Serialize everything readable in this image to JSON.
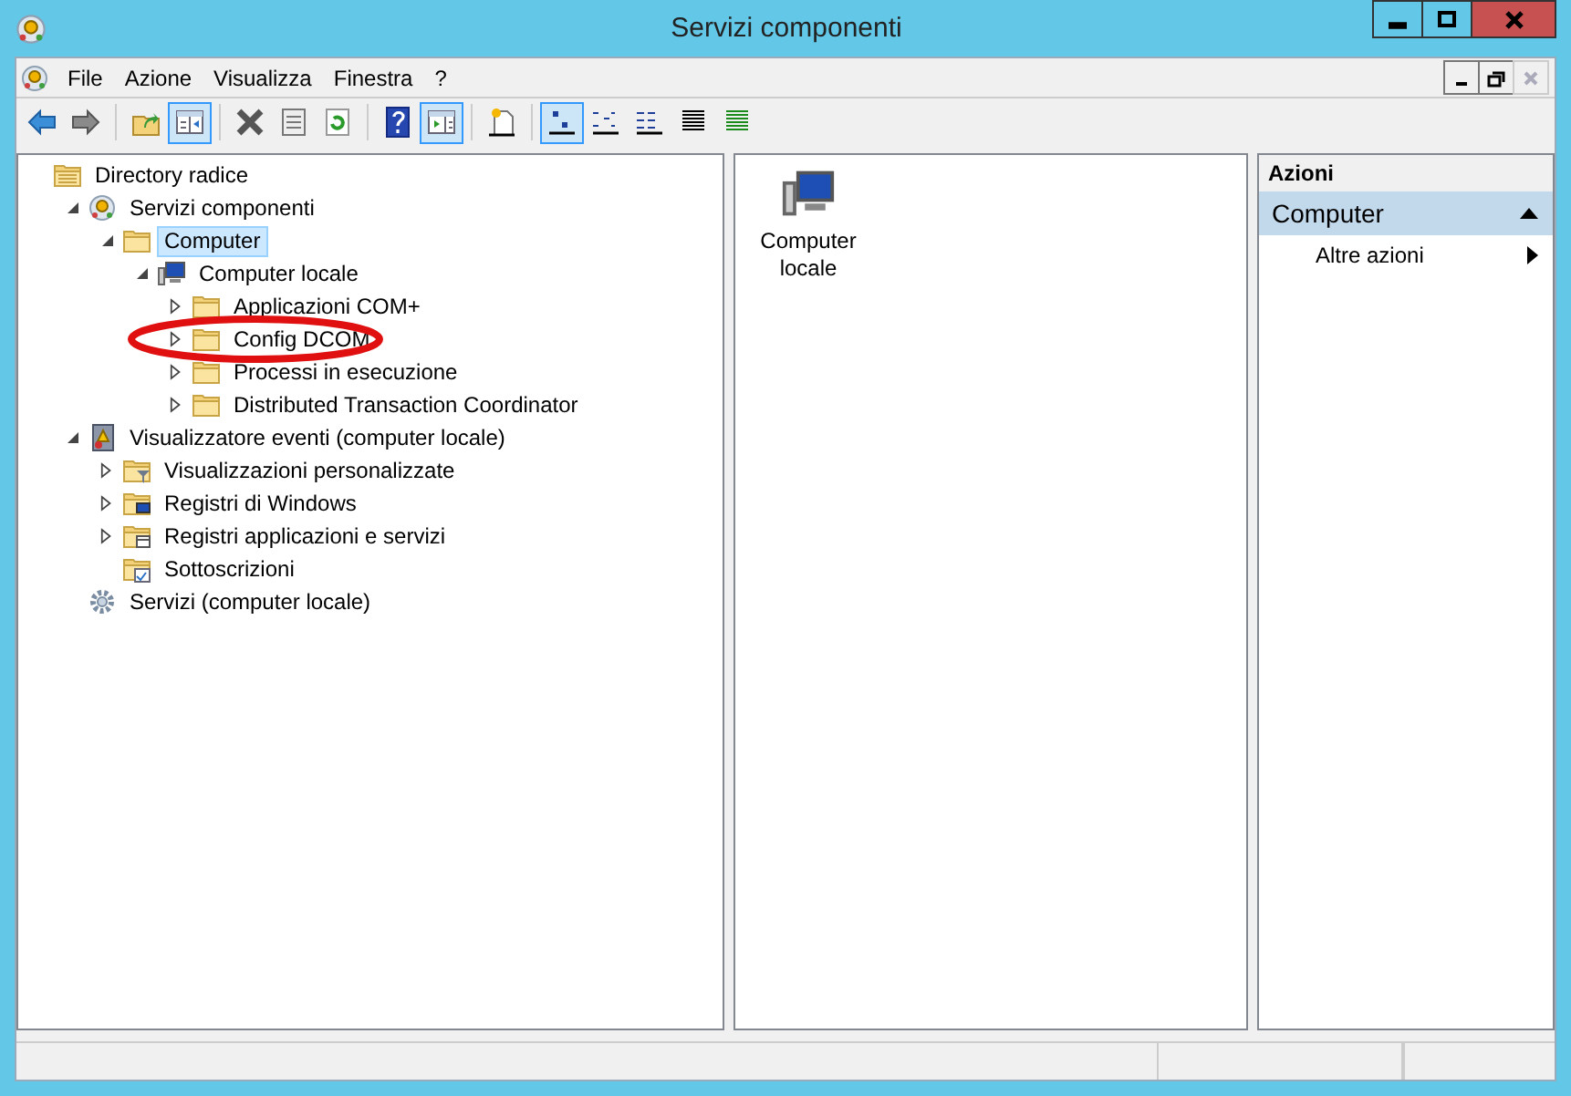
{
  "window": {
    "title": "Servizi componenti"
  },
  "menu": [
    {
      "label": "File"
    },
    {
      "label": "Azione"
    },
    {
      "label": "Visualizza"
    },
    {
      "label": "Finestra"
    },
    {
      "label": "?"
    }
  ],
  "toolbar": [
    {
      "kind": "back",
      "pressed": false
    },
    {
      "kind": "forward",
      "pressed": false
    },
    {
      "kind": "sep"
    },
    {
      "kind": "up",
      "pressed": false
    },
    {
      "kind": "tree",
      "pressed": true
    },
    {
      "kind": "sep"
    },
    {
      "kind": "delete",
      "pressed": false
    },
    {
      "kind": "properties",
      "pressed": false
    },
    {
      "kind": "refresh",
      "pressed": false
    },
    {
      "kind": "sep"
    },
    {
      "kind": "help",
      "pressed": false
    },
    {
      "kind": "actions",
      "pressed": true
    },
    {
      "kind": "sep"
    },
    {
      "kind": "newwin",
      "pressed": false
    },
    {
      "kind": "sep"
    },
    {
      "kind": "large",
      "pressed": true
    },
    {
      "kind": "small",
      "pressed": false
    },
    {
      "kind": "list",
      "pressed": false
    },
    {
      "kind": "detail",
      "pressed": false
    },
    {
      "kind": "custom",
      "pressed": false
    }
  ],
  "tree": [
    {
      "label": "Directory radice",
      "kind": "root",
      "selected": false,
      "children": [
        {
          "label": "Servizi componenti",
          "kind": "snapin",
          "expanded": true,
          "selected": false,
          "children": [
            {
              "label": "Computer",
              "kind": "folder",
              "expanded": true,
              "selected": true,
              "children": [
                {
                  "label": "Computer locale",
                  "kind": "computer",
                  "expanded": true,
                  "selected": false,
                  "children": [
                    {
                      "label": "Applicazioni COM+",
                      "kind": "folder",
                      "expanded": false,
                      "selected": false
                    },
                    {
                      "label": "Config DCOM",
                      "kind": "folder",
                      "expanded": false,
                      "selected": false,
                      "annotated": true
                    },
                    {
                      "label": "Processi in esecuzione",
                      "kind": "folder",
                      "expanded": false,
                      "selected": false
                    },
                    {
                      "label": "Distributed Transaction Coordinator",
                      "kind": "folder",
                      "expanded": false,
                      "selected": false
                    }
                  ]
                }
              ]
            }
          ]
        },
        {
          "label": "Visualizzatore eventi (computer locale)",
          "kind": "eventlog",
          "expanded": true,
          "selected": false,
          "children": [
            {
              "label": "Visualizzazioni personalizzate",
              "kind": "filter",
              "expanded": false,
              "selected": false
            },
            {
              "label": "Registri di Windows",
              "kind": "logs",
              "expanded": false,
              "selected": false
            },
            {
              "label": "Registri applicazioni e servizi",
              "kind": "applogs",
              "expanded": false,
              "selected": false
            },
            {
              "label": "Sottoscrizioni",
              "kind": "subs",
              "selected": false
            }
          ]
        },
        {
          "label": "Servizi (computer locale)",
          "kind": "gear",
          "selected": false
        }
      ]
    }
  ],
  "content": {
    "items": [
      {
        "label": "Computer locale"
      }
    ]
  },
  "actions": {
    "title": "Azioni",
    "sections": [
      {
        "title": "Computer",
        "expanded": true,
        "items": [
          {
            "label": "Altre azioni"
          }
        ]
      }
    ]
  }
}
